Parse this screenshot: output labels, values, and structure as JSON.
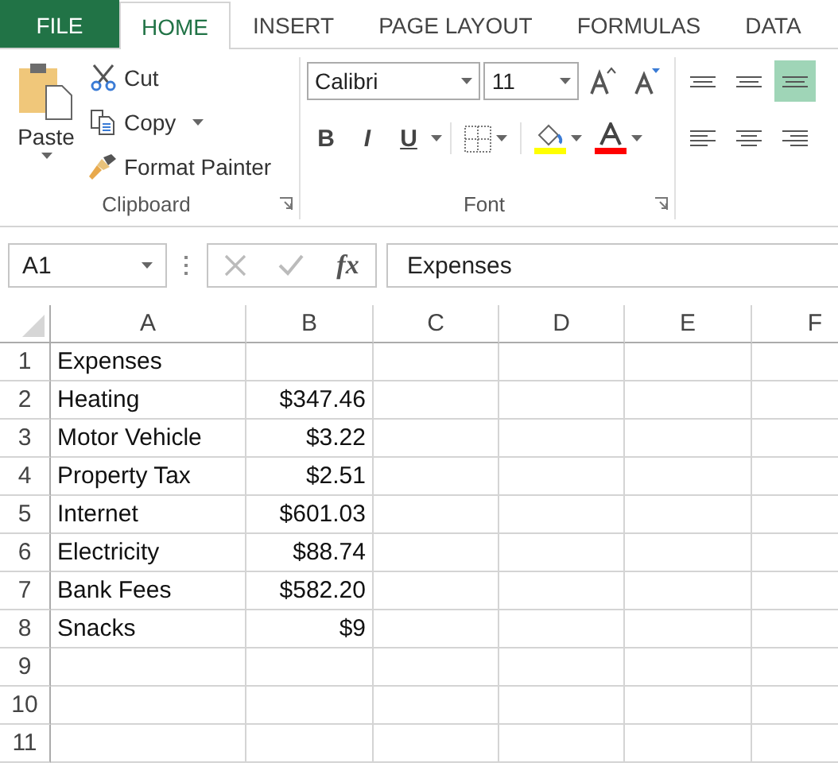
{
  "tabs": [
    {
      "label": "FILE",
      "kind": "file",
      "selected": false
    },
    {
      "label": "HOME",
      "kind": "tab",
      "selected": true
    },
    {
      "label": "INSERT",
      "kind": "tab",
      "selected": false
    },
    {
      "label": "PAGE LAYOUT",
      "kind": "tab",
      "selected": false
    },
    {
      "label": "FORMULAS",
      "kind": "tab",
      "selected": false
    },
    {
      "label": "DATA",
      "kind": "tab",
      "selected": false
    }
  ],
  "clipboard": {
    "paste": "Paste",
    "commands": [
      {
        "label": "Cut",
        "kind": "cut",
        "dropdown": false
      },
      {
        "label": "Copy",
        "kind": "copy",
        "dropdown": true
      },
      {
        "label": "Format Painter",
        "kind": "painter",
        "dropdown": false
      }
    ],
    "group_label": "Clipboard"
  },
  "font": {
    "font_name": "Calibri",
    "font_size": "11",
    "format_buttons": [
      {
        "label": "B",
        "kind": "bold"
      },
      {
        "label": "I",
        "kind": "italic"
      },
      {
        "label": "U",
        "kind": "underline"
      }
    ],
    "color_buttons": [
      {
        "kind": "fill",
        "color": "#ffff00"
      },
      {
        "kind": "font",
        "color": "#ff0000"
      }
    ],
    "group_label": "Font"
  },
  "alignment": {
    "buttons": [
      {
        "kind": "top",
        "selected": false
      },
      {
        "kind": "middle",
        "selected": false
      },
      {
        "kind": "bottom",
        "selected": true
      },
      {
        "kind": "left",
        "selected": false
      },
      {
        "kind": "center",
        "selected": false
      },
      {
        "kind": "right",
        "selected": false
      }
    ]
  },
  "formula_bar": {
    "name_box": "A1",
    "function_symbol": "fx",
    "formula": "Expenses"
  },
  "sheet": {
    "columns": [
      "A",
      "B",
      "C",
      "D",
      "E",
      "F"
    ],
    "rows": [
      {
        "number": "1",
        "cells": [
          "Expenses",
          ""
        ]
      },
      {
        "number": "2",
        "cells": [
          "Heating",
          "$347.46"
        ]
      },
      {
        "number": "3",
        "cells": [
          "Motor Vehicle",
          "$3.22"
        ]
      },
      {
        "number": "4",
        "cells": [
          "Property Tax",
          "$2.51"
        ]
      },
      {
        "number": "5",
        "cells": [
          "Internet",
          "$601.03"
        ]
      },
      {
        "number": "6",
        "cells": [
          "Electricity",
          "$88.74"
        ]
      },
      {
        "number": "7",
        "cells": [
          "Bank Fees",
          "$582.20"
        ]
      },
      {
        "number": "8",
        "cells": [
          "Snacks",
          "$9"
        ]
      },
      {
        "number": "9",
        "cells": [
          "",
          ""
        ]
      },
      {
        "number": "10",
        "cells": [
          "",
          ""
        ]
      },
      {
        "number": "11",
        "cells": [
          "",
          ""
        ]
      }
    ]
  }
}
